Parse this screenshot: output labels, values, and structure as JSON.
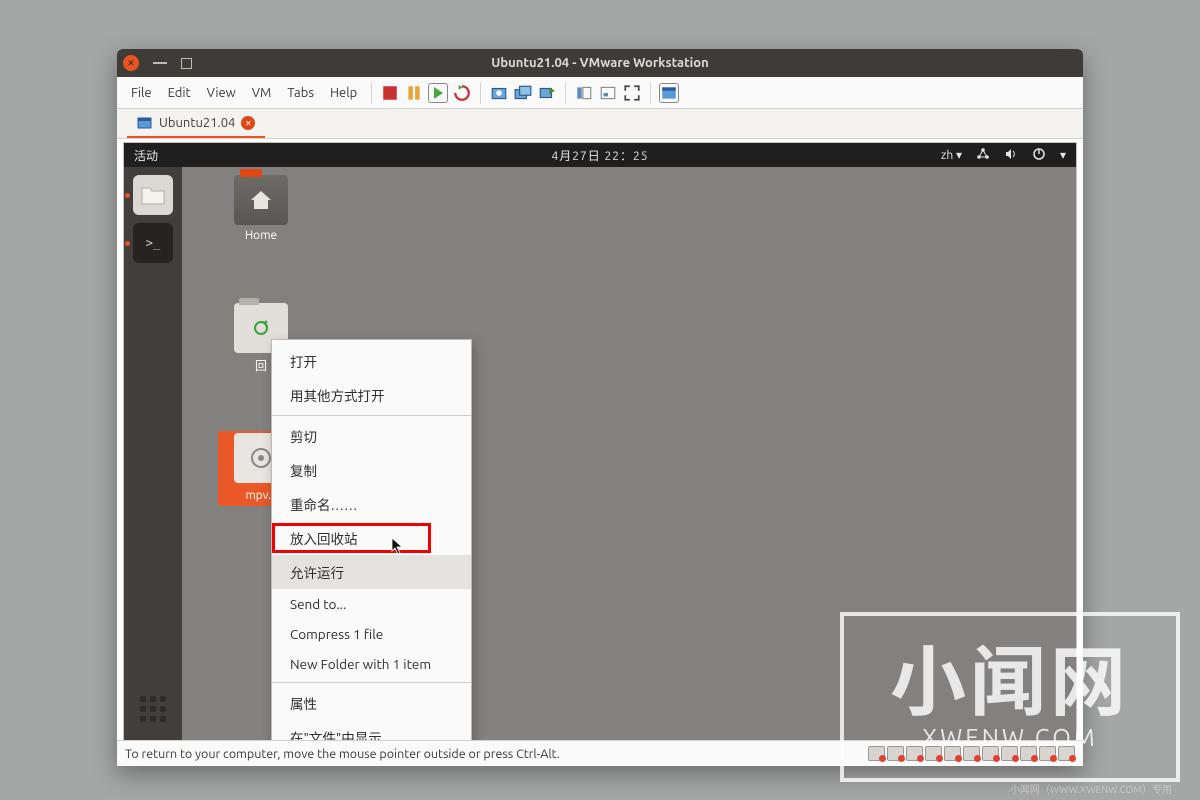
{
  "window": {
    "title": "Ubuntu21.04 - VMware Workstation"
  },
  "menubar": {
    "items": [
      "File",
      "Edit",
      "View",
      "VM",
      "Tabs",
      "Help"
    ]
  },
  "tab": {
    "label": "Ubuntu21.04"
  },
  "gnome": {
    "activities": "活动",
    "datetime": "4月27日  22：25",
    "input_method": "zh"
  },
  "desktop": {
    "home_label": "Home",
    "trash_label": "回",
    "selected_label": "mpv.c"
  },
  "context_menu": {
    "open": "打开",
    "open_with": "用其他方式打开",
    "cut": "剪切",
    "copy": "复制",
    "rename": "重命名……",
    "move_to_trash": "放入回收站",
    "allow_run": "允许运行",
    "send_to": "Send to...",
    "compress": "Compress 1 file",
    "new_folder": "New Folder with 1 item",
    "properties": "属性",
    "show_in_files": "在\"文件\"中显示"
  },
  "statusbar": {
    "hint": "To return to your computer, move the mouse pointer outside or press Ctrl-Alt."
  },
  "watermark": {
    "text": "小闻网",
    "url": "XWENW.COM",
    "footer": "小闻网（WWW.XWENW.COM）专用"
  }
}
